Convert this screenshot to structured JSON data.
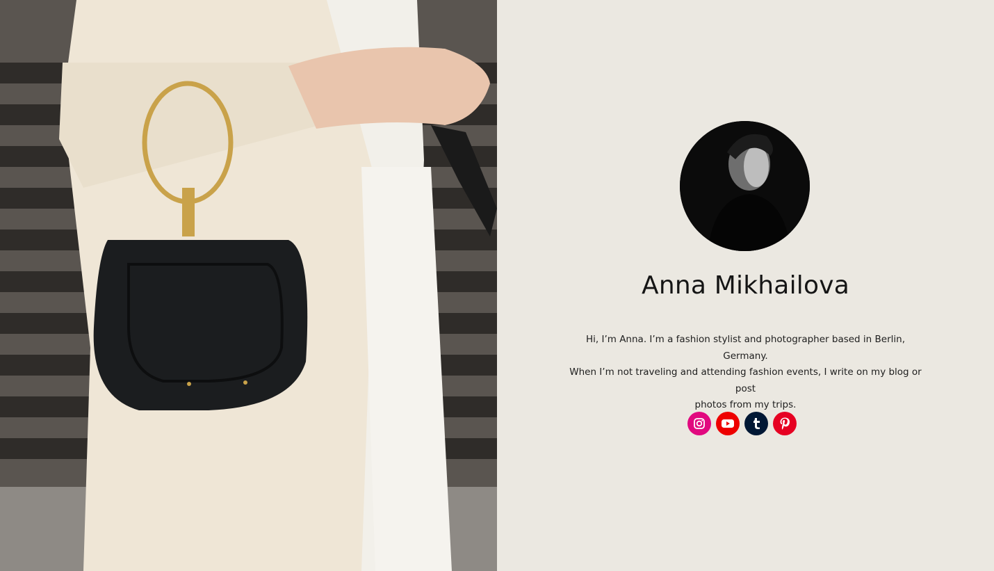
{
  "profile": {
    "name": "Anna Mikhailova",
    "bio_lines": [
      "Hi, I’m Anna. I’m a fashion stylist and photographer based in Berlin, Germany.",
      "When I’m not traveling and attending fashion events, I write on my blog or post",
      "photos from my trips."
    ]
  },
  "socials": [
    {
      "name": "instagram",
      "icon": "instagram-icon",
      "color": "#e1097f"
    },
    {
      "name": "youtube",
      "icon": "youtube-icon",
      "color": "#ee0000"
    },
    {
      "name": "tumblr",
      "icon": "tumblr-icon",
      "color": "#011835"
    },
    {
      "name": "pinterest",
      "icon": "pinterest-icon",
      "color": "#e60122"
    }
  ],
  "colors": {
    "background": "#ebe8e1",
    "text": "#151515"
  }
}
